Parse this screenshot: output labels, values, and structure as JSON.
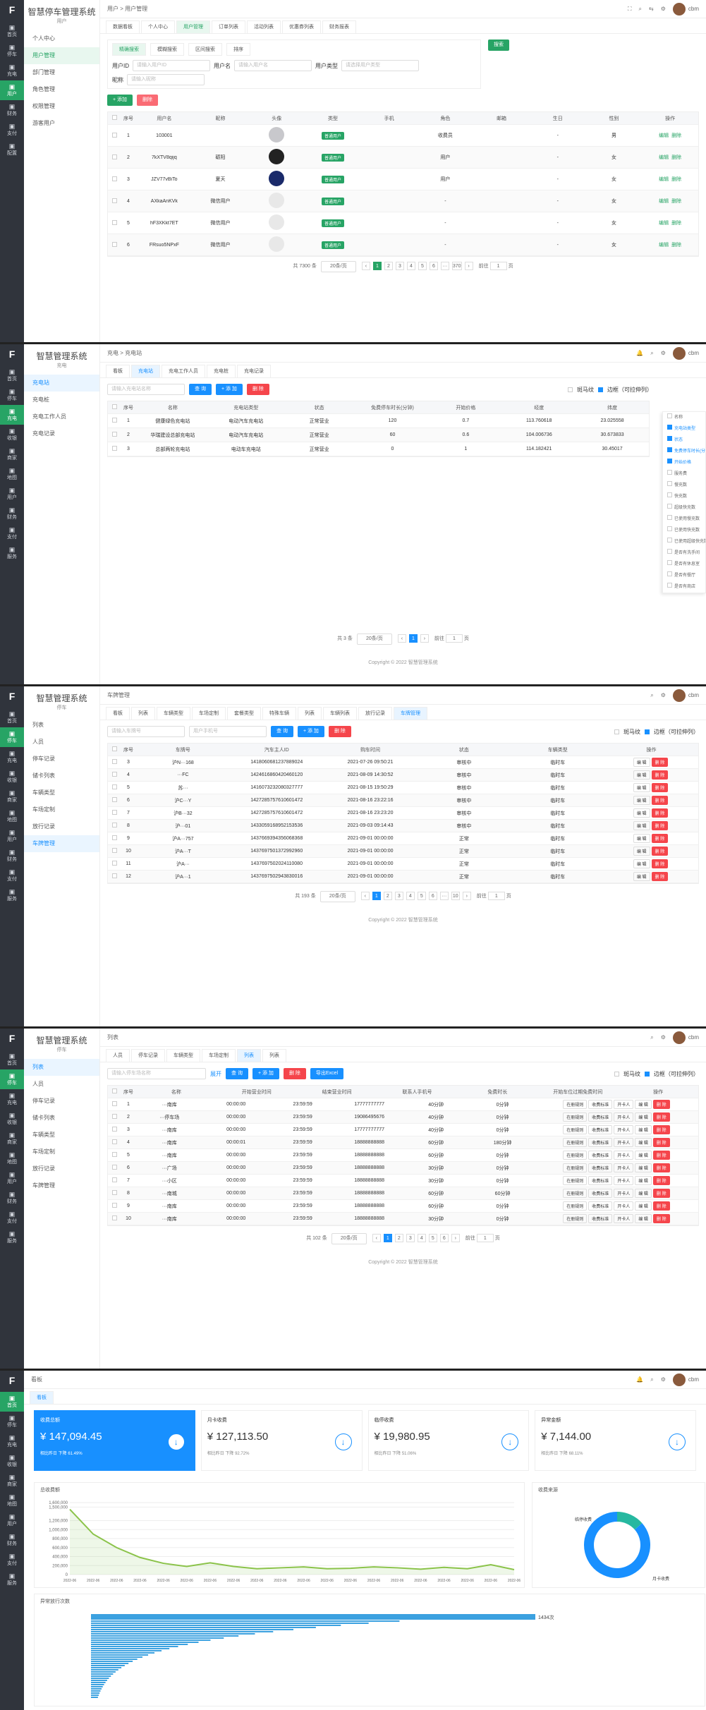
{
  "app": {
    "title": "智慧停车管理系统",
    "title2": "智慧管理系统"
  },
  "s1": {
    "rail": [
      "首页",
      "停车",
      "充电",
      "用户",
      "财务",
      "支付",
      "配置"
    ],
    "sub_sub": "用户",
    "menu": [
      "个人中心",
      "用户管理",
      "部门管理",
      "角色管理",
      "权限管理",
      "游客用户"
    ],
    "crumb": "用户 > 用户管理",
    "user": "cbm",
    "tabs": [
      "数据看板",
      "个人中心",
      "用户管理",
      "订单列表",
      "活动列表",
      "优惠券列表",
      "财务报表"
    ],
    "filter_tabs": [
      "精确搜索",
      "模糊搜索",
      "区间搜索",
      "排序"
    ],
    "labels": {
      "phone": "用户ID",
      "name": "用户名",
      "type": "用户类型",
      "nick": "昵称"
    },
    "placeholders": {
      "phone": "请输入用户ID",
      "name": "请输入用户名",
      "type": "请选择用户类型",
      "nick": "请输入昵称"
    },
    "search": "搜索",
    "add": "+ 添加",
    "del": "删除",
    "cols": [
      "序号",
      "用户名",
      "昵称",
      "头像",
      "类型",
      "手机",
      "角色",
      "邮箱",
      "生日",
      "性别",
      "操作"
    ],
    "rows": [
      [
        "1",
        "103001",
        "",
        "",
        "普通用户",
        "",
        "收费员",
        "",
        "-",
        "男"
      ],
      [
        "2",
        "7kXTV8qijq",
        "砺阳",
        "",
        "普通用户",
        "",
        "用户",
        "",
        "-",
        "女"
      ],
      [
        "3",
        "JZV77vBiTo",
        "夏天",
        "",
        "普通用户",
        "",
        "用户",
        "",
        "-",
        "女"
      ],
      [
        "4",
        "AXkaAnKVk",
        "微信用户",
        "",
        "普通用户",
        "",
        "-",
        "",
        "-",
        "女"
      ],
      [
        "5",
        "hF3XKkt7ET",
        "微信用户",
        "",
        "普通用户",
        "",
        "-",
        "",
        "-",
        "女"
      ],
      [
        "6",
        "FRsuo5NPxF",
        "微信用户",
        "",
        "普通用户",
        "",
        "-",
        "",
        "-",
        "女"
      ]
    ],
    "ops": [
      "编辑",
      "删除"
    ],
    "pager": {
      "total": "共 7300 条",
      "size": "20条/页",
      "pages": [
        "1",
        "2",
        "3",
        "4",
        "5",
        "6",
        "···",
        "370"
      ],
      "goto": "前往",
      "page": "1",
      "unit": "页"
    }
  },
  "s2": {
    "rail": [
      "首页",
      "停车",
      "充电",
      "收银",
      "商家",
      "地图",
      "用户",
      "财务",
      "支付",
      "服务"
    ],
    "sub_sub": "充电",
    "menu": [
      "充电站",
      "充电桩",
      "充电工作人员",
      "充电记录"
    ],
    "crumb": "充电 > 充电站",
    "tabs": [
      "看板",
      "充电站",
      "充电工作人员",
      "充电桩",
      "充电记录"
    ],
    "placeholder": "请输入充电站名称",
    "search": "查 询",
    "add": "+ 添 加",
    "del": "删 除",
    "opts": [
      "斑马纹",
      "边框（可拉伸列）"
    ],
    "cols": [
      "序号",
      "名称",
      "充电站类型",
      "状态",
      "免费停车时长(分钟)",
      "开始价格",
      "经度",
      "纬度"
    ],
    "rows": [
      [
        "1",
        "健康绿色充电站",
        "电动汽车充电站",
        "正常营业",
        "120",
        "0.7",
        "113.760618",
        "23.025558"
      ],
      [
        "2",
        "华瑞建设总部充电站",
        "电动汽车充电站",
        "正常营业",
        "60",
        "0.6",
        "104.006736",
        "30.673833"
      ],
      [
        "3",
        "总部两轮充电站",
        "电动车充电站",
        "正常营业",
        "0",
        "1",
        "114.182421",
        "30.45017"
      ]
    ],
    "colmenu": [
      "名称",
      "充电站类型",
      "状态",
      "免费停车时长(分钟)",
      "开始价格",
      "服务费",
      "慢充数",
      "快充数",
      "超级快充数",
      "已使用慢充数",
      "已使用快充数",
      "已使用超级快充数",
      "是否有洗手间",
      "是否有休息室",
      "是否有餐厅",
      "是否有商店"
    ],
    "pager": {
      "total": "共 3 条",
      "size": "20条/页",
      "pages": [
        "1"
      ],
      "goto": "前往",
      "page": "1",
      "unit": "页"
    },
    "copy": "Copyright © 2022 智慧管理系统"
  },
  "s3": {
    "rail": [
      "首页",
      "停车",
      "充电",
      "收银",
      "商家",
      "地图",
      "用户",
      "财务",
      "支付",
      "服务"
    ],
    "sub_sub": "停车",
    "menu": [
      "列表",
      "人员",
      "停车记录",
      "储卡列表",
      "车辆类型",
      "车场定制",
      "放行记录",
      "车牌管理"
    ],
    "crumb": "车牌管理",
    "tabs": [
      "看板",
      "列表",
      "车辆类型",
      "车场定制",
      "套餐类型",
      "特殊车辆",
      "列表",
      "车辆列表",
      "放行记录",
      "车牌管理"
    ],
    "ph1": "请输入车牌号",
    "ph2": "用户手机号",
    "search": "查 询",
    "add": "+ 添 加",
    "del": "删 除",
    "opts": [
      "斑马纹",
      "边框（可拉伸列）"
    ],
    "cols": [
      "序号",
      "车牌号",
      "汽车主人ID",
      "购车时间",
      "状态",
      "车辆类型",
      "操作"
    ],
    "rows": [
      [
        "3",
        "沪N···168",
        "1418060681237889024",
        "2021-07-26 09:50:21",
        "审核中",
        "临时车"
      ],
      [
        "4",
        "···FC",
        "1424616860420460120",
        "2021-08-09 14:30:52",
        "审核中",
        "临时车"
      ],
      [
        "5",
        "苏···",
        "1416073232080327777",
        "2021-08-15 19:50:29",
        "审核中",
        "临时车"
      ],
      [
        "6",
        "沪C···Y",
        "1427285757610601472",
        "2021-08-16 23:22:16",
        "审核中",
        "临时车"
      ],
      [
        "7",
        "沪B···32",
        "1427285757610601472",
        "2021-08-16 23:23:20",
        "审核中",
        "临时车"
      ],
      [
        "8",
        "沪···01",
        "1433059168952153536",
        "2021-09-03 09:14:43",
        "审核中",
        "临时车"
      ],
      [
        "9",
        "沪A···757",
        "1437669394356068368",
        "2021-09-01 00:00:00",
        "正常",
        "临时车"
      ],
      [
        "10",
        "沪A···T",
        "1437697501372992960",
        "2021-09-01 00:00:00",
        "正常",
        "临时车"
      ],
      [
        "11",
        "沪A···",
        "1437697502024110080",
        "2021-09-01 00:00:00",
        "正常",
        "临时车"
      ],
      [
        "12",
        "沪A···1",
        "1437697502943830016",
        "2021-09-01 00:00:00",
        "正常",
        "临时车"
      ]
    ],
    "ops": [
      "编 辑",
      "删 除"
    ],
    "pager": {
      "total": "共 193 条",
      "size": "20条/页",
      "pages": [
        "1",
        "2",
        "3",
        "4",
        "5",
        "6",
        "···",
        "10"
      ],
      "goto": "前往",
      "page": "1",
      "unit": "页"
    },
    "copy": "Copyright © 2022 智慧管理系统"
  },
  "s4": {
    "crumb": "列表",
    "tabs": [
      "人员",
      "停车记录",
      "车辆类型",
      "车场定制",
      "列表",
      "列表"
    ],
    "ph": "请输入停车场名称",
    "expand": "展开",
    "search": "查 询",
    "add": "+ 添 加",
    "del": "删 除",
    "exp": "导出Excel",
    "cols": [
      "序号",
      "名称",
      "开始营业时间",
      "结束营业时间",
      "联系人手机号",
      "免费时长",
      "开始车位过期免费时间",
      "操作"
    ],
    "rows": [
      [
        "1",
        "···南库",
        "00:00:00",
        "23:59:59",
        "17777777777",
        "40分钟",
        "0分钟"
      ],
      [
        "2",
        "···停车场",
        "00:00:00",
        "23:59:59",
        "19086495676",
        "40分钟",
        "0分钟"
      ],
      [
        "3",
        "···南库",
        "00:00:00",
        "23:59:59",
        "17777777777",
        "40分钟",
        "0分钟"
      ],
      [
        "4",
        "···南库",
        "00:00:01",
        "23:59:59",
        "18888888888",
        "60分钟",
        "180分钟"
      ],
      [
        "5",
        "···南库",
        "00:00:00",
        "23:59:59",
        "18888888888",
        "60分钟",
        "0分钟"
      ],
      [
        "6",
        "···广场",
        "00:00:00",
        "23:59:59",
        "18888888888",
        "30分钟",
        "0分钟"
      ],
      [
        "7",
        "···小区",
        "00:00:00",
        "23:59:59",
        "18888888888",
        "30分钟",
        "0分钟"
      ],
      [
        "8",
        "···南城",
        "00:00:00",
        "23:59:59",
        "18888888888",
        "60分钟",
        "60分钟"
      ],
      [
        "9",
        "···南库",
        "00:00:00",
        "23:59:59",
        "18888888888",
        "60分钟",
        "0分钟"
      ],
      [
        "10",
        "···南库",
        "00:00:00",
        "23:59:59",
        "18888888888",
        "30分钟",
        "0分钟"
      ]
    ],
    "ops": [
      "在册规则",
      "收费标准",
      "开卡人",
      "编 辑",
      "删 除"
    ],
    "pager": {
      "total": "共 102 条",
      "size": "20条/页",
      "pages": [
        "1",
        "2",
        "3",
        "4",
        "5",
        "6"
      ],
      "goto": "前往",
      "page": "1",
      "unit": "页"
    },
    "copy": "Copyright © 2022 智慧管理系统"
  },
  "s5": {
    "crumb": "看板",
    "tab": "看板",
    "cards": [
      {
        "t": "收费总额",
        "v": "¥ 147,094.45",
        "s": "相比昨日 下降 61.49%"
      },
      {
        "t": "月卡收费",
        "v": "¥ 127,113.50",
        "s": "相比昨日 下降 92.72%"
      },
      {
        "t": "临停收费",
        "v": "¥ 19,980.95",
        "s": "相比昨日 下降 51.06%"
      },
      {
        "t": "异常金额",
        "v": "¥ 7,144.00",
        "s": "相比昨日 下降 68.11%"
      }
    ],
    "p1": "总收费额",
    "p2": "收费来源",
    "p3": "异常放行次数",
    "donut": {
      "a": "临停收费",
      "b": "月卡收费",
      "va": 13.6
    },
    "hbar_label": "1434次",
    "arrow": "↓"
  },
  "chart_data": [
    {
      "type": "area",
      "title": "总收费额",
      "y_ticks": [
        "1,600,000",
        "1,500,000",
        "1,200,000",
        "1,000,000",
        "800,000",
        "600,000",
        "400,000",
        "200,000",
        "0"
      ],
      "ylim": [
        0,
        1600000
      ],
      "x": [
        "2022-06",
        "2022-06",
        "2022-06",
        "2022-06",
        "2022-06",
        "2022-06",
        "2022-06",
        "2022-06",
        "2022-06",
        "2022-06",
        "2022-06",
        "2022-06",
        "2022-06",
        "2022-06",
        "2022-06",
        "2022-06",
        "2022-06",
        "2022-06",
        "2022-06",
        "2022-06"
      ],
      "values": [
        1450000,
        900000,
        600000,
        380000,
        250000,
        180000,
        260000,
        180000,
        130000,
        150000,
        170000,
        130000,
        140000,
        170000,
        150000,
        120000,
        160000,
        130000,
        220000,
        110000
      ]
    },
    {
      "type": "pie",
      "title": "收费来源",
      "categories": [
        "临停收费",
        "月卡收费"
      ],
      "values": [
        19980.95,
        127113.5
      ]
    },
    {
      "type": "bar",
      "title": "异常放行次数",
      "values": [
        1434
      ]
    }
  ]
}
